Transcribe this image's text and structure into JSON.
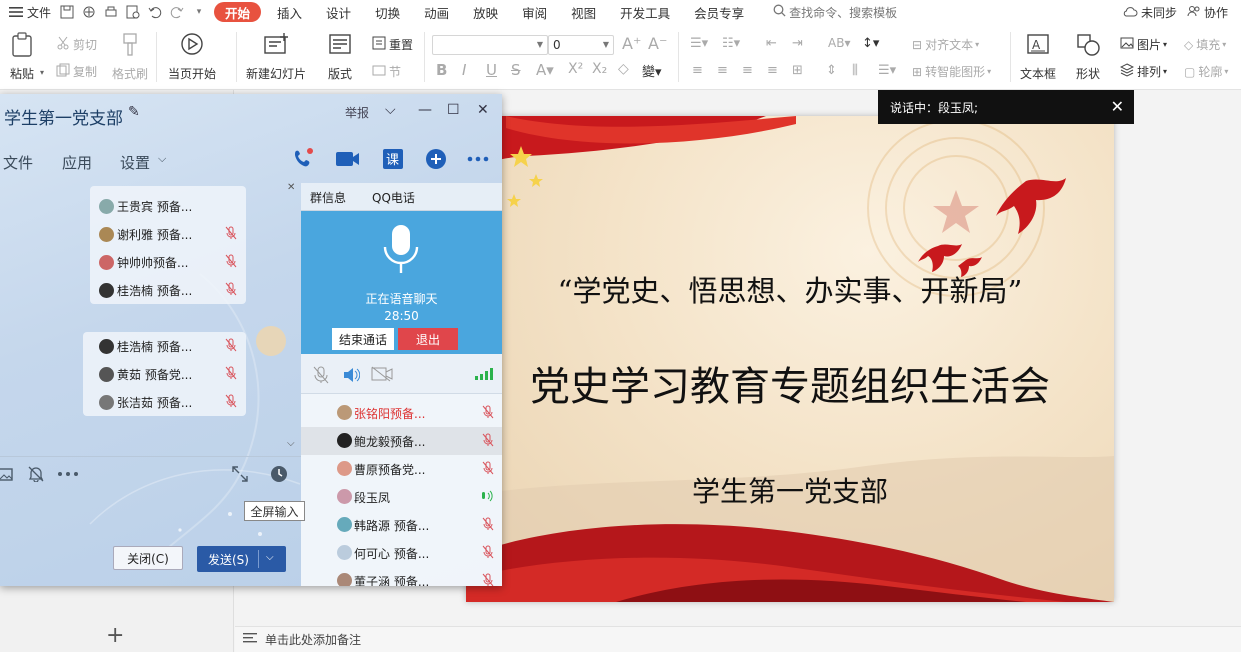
{
  "menubar": {
    "file": "文件",
    "tabs": [
      "开始",
      "插入",
      "设计",
      "切换",
      "动画",
      "放映",
      "审阅",
      "视图",
      "开发工具",
      "会员专享"
    ],
    "active_tab": "开始",
    "search_placeholder": "查找命令、搜索模板",
    "sync": "未同步",
    "collab": "协作"
  },
  "ribbon": {
    "paste": "粘贴",
    "cut": "剪切",
    "copy": "复制",
    "format_painter": "格式刷",
    "from_current": "当页开始",
    "new_slide": "新建幻灯片",
    "layout": "版式",
    "reset": "重置",
    "section": "节",
    "font_size": "0",
    "text_box": "文本框",
    "shapes": "形状",
    "picture": "图片",
    "arrange": "排列",
    "fill": "填充",
    "outline": "轮廓",
    "align_text": "对齐文本",
    "smart_art": "转智能图形"
  },
  "tooltip": {
    "speaking": "说话中：段玉凤;"
  },
  "slide": {
    "quote": "“学党史、悟思想、办实事、开新局”",
    "title": "党史学习教育专题组织生活会",
    "org": "学生第一党支部"
  },
  "notes": {
    "placeholder": "单击此处添加备注"
  },
  "chat": {
    "title": "学生第一党支部",
    "report": "举报",
    "menu": [
      "文件",
      "应用",
      "设置"
    ],
    "panel_tabs": [
      "群信息",
      "QQ电话"
    ],
    "voice_status": "正在语音聊天",
    "voice_time": "28:50",
    "end_call": "结束通话",
    "exit": "退出",
    "left_members_a": [
      "王贵宾 预备...",
      "谢利雅 预备...",
      "钟帅帅预备...",
      "桂浩楠 预备..."
    ],
    "left_members_b": [
      "桂浩楠 预备...",
      "黄茹 预备党...",
      "张洁茹 预备..."
    ],
    "right_members": [
      "张铭阳预备...",
      "鲍龙毅预备...",
      "曹原预备党...",
      "段玉凤",
      "韩路源 预备...",
      "何可心 预备...",
      "董子涵 预备..."
    ],
    "fullscreen_tip": "全屏输入",
    "close_btn": "关闭(C)",
    "send_btn": "发送(S)"
  },
  "colors": {
    "active_tab": "#e8523f",
    "voice_panel": "#4aa6de",
    "exit_button": "#e0464b",
    "send_button": "#2a5aa6",
    "speaking_icon": "#2bb24c",
    "muted_icon": "#d9545c"
  }
}
